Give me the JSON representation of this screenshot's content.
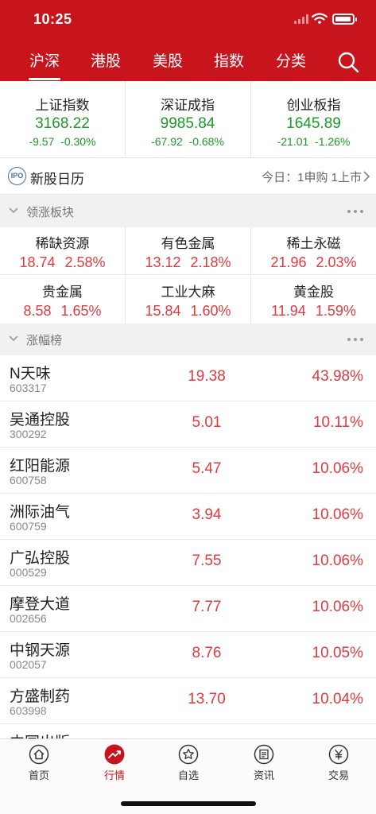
{
  "status": {
    "time": "10:25"
  },
  "tabs": [
    {
      "label": "沪深",
      "active": true
    },
    {
      "label": "港股",
      "active": false
    },
    {
      "label": "美股",
      "active": false
    },
    {
      "label": "指数",
      "active": false
    },
    {
      "label": "分类",
      "active": false
    }
  ],
  "indices": [
    {
      "name": "上证指数",
      "price": "3168.22",
      "change": "-9.57",
      "pct": "-0.30%"
    },
    {
      "name": "深证成指",
      "price": "9985.84",
      "change": "-67.92",
      "pct": "-0.68%"
    },
    {
      "name": "创业板指",
      "price": "1645.89",
      "change": "-21.01",
      "pct": "-1.26%"
    }
  ],
  "ipo": {
    "icon_text": "IPO",
    "title": "新股日历",
    "today": "今日：1申购 1上市"
  },
  "sections": {
    "leading_sectors": "领涨板块",
    "top_gainers": "涨幅榜"
  },
  "sectors": [
    {
      "name": "稀缺资源",
      "value": "18.74",
      "pct": "2.58%"
    },
    {
      "name": "有色金属",
      "value": "13.12",
      "pct": "2.18%"
    },
    {
      "name": "稀土永磁",
      "value": "21.96",
      "pct": "2.03%"
    },
    {
      "name": "贵金属",
      "value": "8.58",
      "pct": "1.65%"
    },
    {
      "name": "工业大麻",
      "value": "15.84",
      "pct": "1.60%"
    },
    {
      "name": "黄金股",
      "value": "11.94",
      "pct": "1.59%"
    }
  ],
  "stocks": [
    {
      "name": "N天味",
      "code": "603317",
      "price": "19.38",
      "pct": "43.98%"
    },
    {
      "name": "吴通控股",
      "code": "300292",
      "price": "5.01",
      "pct": "10.11%"
    },
    {
      "name": "红阳能源",
      "code": "600758",
      "price": "5.47",
      "pct": "10.06%"
    },
    {
      "name": "洲际油气",
      "code": "600759",
      "price": "3.94",
      "pct": "10.06%"
    },
    {
      "name": "广弘控股",
      "code": "000529",
      "price": "7.55",
      "pct": "10.06%"
    },
    {
      "name": "摩登大道",
      "code": "002656",
      "price": "7.77",
      "pct": "10.06%"
    },
    {
      "name": "中钢天源",
      "code": "002057",
      "price": "8.76",
      "pct": "10.05%"
    },
    {
      "name": "方盛制药",
      "code": "603998",
      "price": "13.70",
      "pct": "10.04%"
    },
    {
      "name": "中国出版",
      "code": "",
      "price": "",
      "pct": ""
    }
  ],
  "nav": [
    {
      "label": "首页",
      "icon": "home-icon",
      "active": false
    },
    {
      "label": "行情",
      "icon": "market-trend-icon",
      "active": true
    },
    {
      "label": "自选",
      "icon": "star-icon",
      "active": false
    },
    {
      "label": "资讯",
      "icon": "news-icon",
      "active": false
    },
    {
      "label": "交易",
      "icon": "yuan-trade-icon",
      "active": false
    }
  ],
  "colors": {
    "brand": "#c8141d",
    "up": "#e23a3f",
    "down": "#1a9a28"
  }
}
